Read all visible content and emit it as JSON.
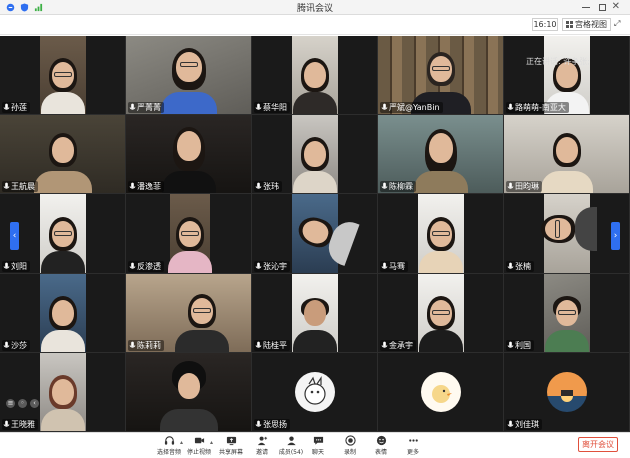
{
  "app": {
    "title": "腾讯会议"
  },
  "topbar": {
    "time": "16:10",
    "view_label": "宫格视图"
  },
  "speaking": {
    "label": "正在讲话: 许争张;"
  },
  "participants": [
    {
      "name": "孙莲",
      "muted": false
    },
    {
      "name": "严菁菁",
      "muted": false
    },
    {
      "name": "蔡华阳",
      "muted": false
    },
    {
      "name": "严斌@YanBin",
      "muted": false
    },
    {
      "name": "路萌萌-南亚大",
      "muted": false
    },
    {
      "name": "王航晨",
      "muted": false
    },
    {
      "name": "潘逸菲",
      "muted": false
    },
    {
      "name": "张玮",
      "muted": false
    },
    {
      "name": "陈柳霖",
      "muted": false
    },
    {
      "name": "田昀琳",
      "muted": false
    },
    {
      "name": "刘阳",
      "muted": false
    },
    {
      "name": "反渗透",
      "muted": false
    },
    {
      "name": "张沁宇",
      "muted": false
    },
    {
      "name": "马骞",
      "muted": false
    },
    {
      "name": "张楠",
      "muted": false
    },
    {
      "name": "沙莎",
      "muted": false
    },
    {
      "name": "陈莉莉",
      "muted": false
    },
    {
      "name": "陆桂平",
      "muted": false
    },
    {
      "name": "金承宇",
      "muted": false
    },
    {
      "name": "利国",
      "muted": false
    },
    {
      "name": "王晓雅",
      "muted": false
    },
    {
      "name": "",
      "muted": false
    },
    {
      "name": "张思扬",
      "muted": false
    },
    {
      "name": "",
      "muted": false
    },
    {
      "name": "刘佳琪",
      "muted": false
    }
  ],
  "toolbar": {
    "audio": "选择音频",
    "video": "停止视频",
    "share": "共享屏幕",
    "invite": "邀请",
    "members": "成员(54)",
    "chat": "聊天",
    "record": "录制",
    "reactions": "表情",
    "more": "更多",
    "leave": "离开会议"
  },
  "colors": {
    "accent": "#2f6ff0",
    "leave": "#e0503c"
  }
}
